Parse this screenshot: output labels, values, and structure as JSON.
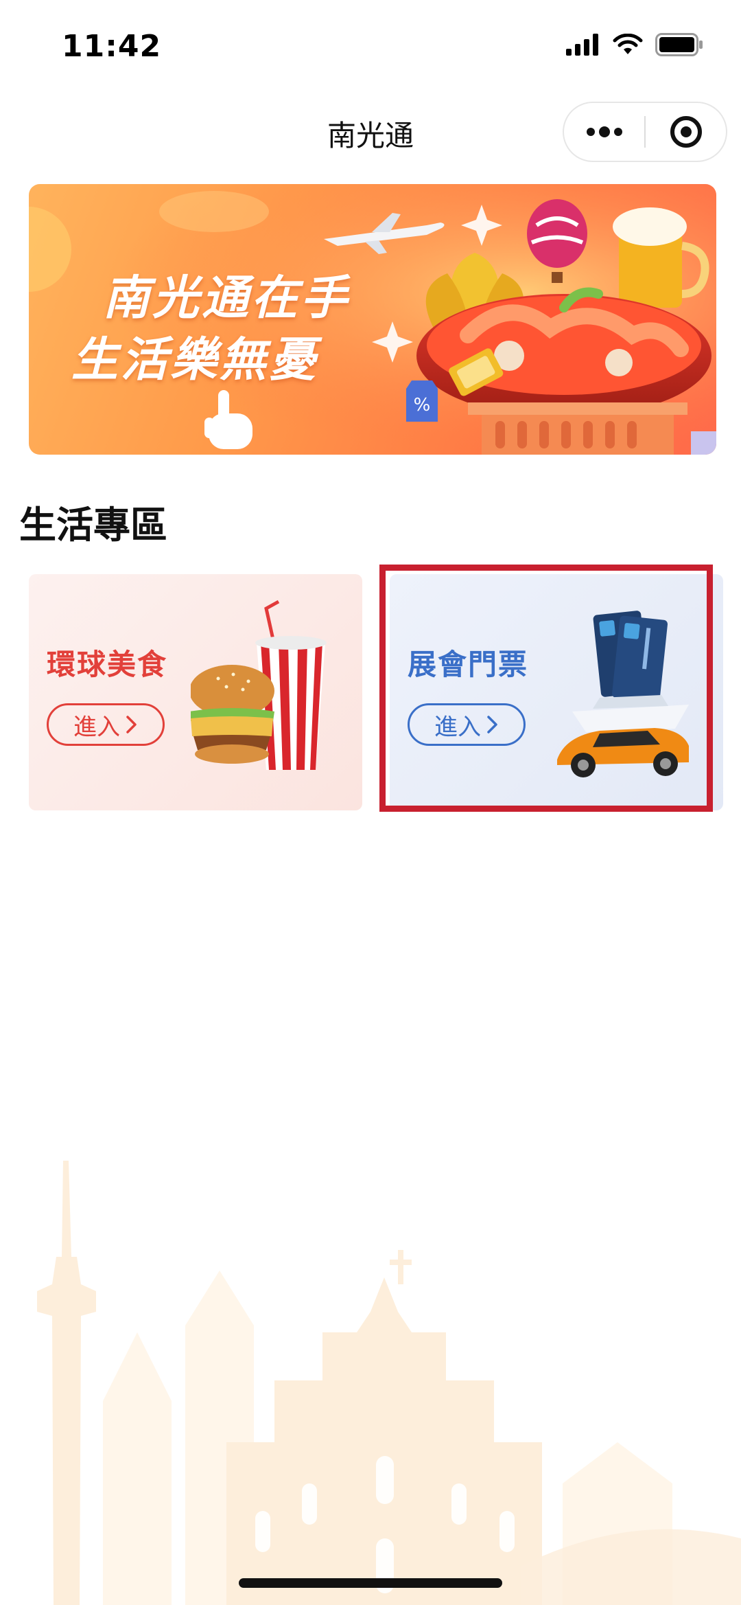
{
  "status_bar": {
    "time": "11:42",
    "icons": [
      "signal-icon",
      "wifi-icon",
      "battery-icon"
    ]
  },
  "nav": {
    "title": "南光通",
    "capsule_icons": [
      "more-icon",
      "close-target-icon"
    ]
  },
  "banner": {
    "line1": "南光通在手",
    "line2": "生活樂無憂"
  },
  "section": {
    "title": "生活專區"
  },
  "cards": [
    {
      "title": "環球美食",
      "button_label": "進入",
      "color": "#e2403a"
    },
    {
      "title": "展會門票",
      "button_label": "進入",
      "color": "#3a6fc8"
    }
  ],
  "colors": {
    "highlight": "#c8202f",
    "banner_orange": "#ff8a48"
  }
}
